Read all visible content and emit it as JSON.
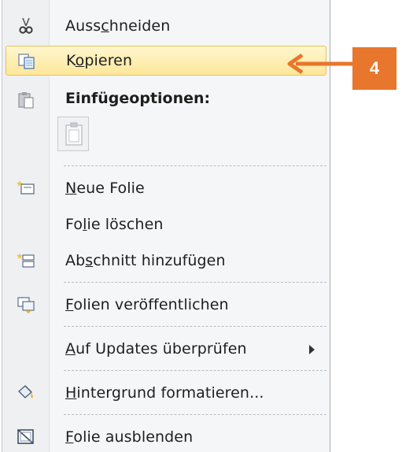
{
  "menu": {
    "items": [
      {
        "id": "ausschneiden",
        "pre": "Auss",
        "ul": "c",
        "post": "hneiden",
        "icon": "scissors-icon"
      },
      {
        "id": "kopieren",
        "pre": "K",
        "ul": "o",
        "post": "pieren",
        "icon": "copy-icon"
      },
      {
        "id": "neue-folie",
        "pre": "",
        "ul": "N",
        "post": "eue Folie",
        "icon": "new-slide-icon"
      },
      {
        "id": "folie-loeschen",
        "pre": "Fo",
        "ul": "l",
        "post": "ie löschen",
        "icon": ""
      },
      {
        "id": "abschnitt",
        "pre": "Ab",
        "ul": "s",
        "post": "chnitt hinzufügen",
        "icon": "add-section-icon"
      },
      {
        "id": "veroeffentlichen",
        "pre": "",
        "ul": "F",
        "post": "olien veröffentlichen",
        "icon": "publish-slides-icon"
      },
      {
        "id": "updates",
        "pre": "",
        "ul": "A",
        "post": "uf Updates überprüfen",
        "icon": ""
      },
      {
        "id": "hintergrund",
        "pre": "",
        "ul": "H",
        "post": "intergrund formatieren...",
        "icon": "format-background-icon"
      },
      {
        "id": "ausblenden",
        "pre": "",
        "ul": "F",
        "post": "olie ausblenden",
        "icon": "hide-slide-icon"
      }
    ],
    "paste_header": "Einfügeoptionen:"
  },
  "callout": {
    "number": "4",
    "color": "#e8762c"
  },
  "highlight_color": "#fde79a"
}
